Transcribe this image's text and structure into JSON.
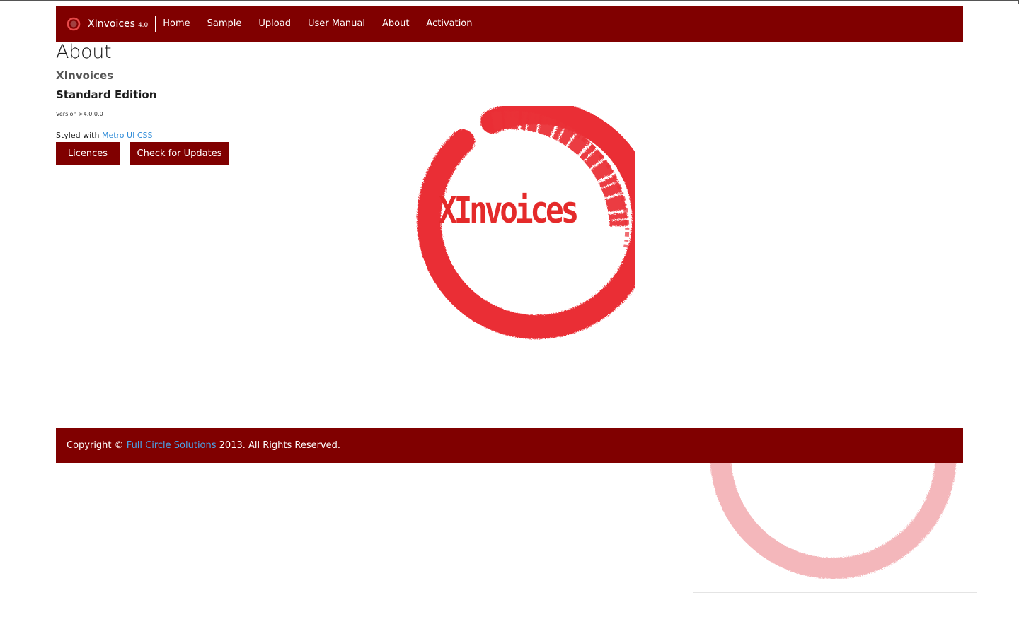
{
  "app": {
    "brand_name": "XInvoices",
    "brand_version": "4.0"
  },
  "nav": {
    "items": [
      {
        "label": "Home"
      },
      {
        "label": "Sample"
      },
      {
        "label": "Upload"
      },
      {
        "label": "User Manual"
      },
      {
        "label": "About"
      },
      {
        "label": "Activation"
      }
    ]
  },
  "page": {
    "title": "About",
    "product_name": "XInvoices",
    "edition": "Standard Edition",
    "version_text": "Version >4.0.0.0",
    "styled_prefix": "Styled with ",
    "styled_link": "Metro UI CSS"
  },
  "buttons": {
    "licences": "Licences",
    "check_updates": "Check for Updates"
  },
  "logo": {
    "text": "XInvoices",
    "icon": "brush-circle-logo"
  },
  "footer": {
    "prefix": "Copyright © ",
    "link": "Full Circle Solutions",
    "suffix": " 2013. All Rights Reserved."
  },
  "colors": {
    "brand": "#800000",
    "logo_red": "#e42a2a",
    "link": "#2e8bd8"
  }
}
